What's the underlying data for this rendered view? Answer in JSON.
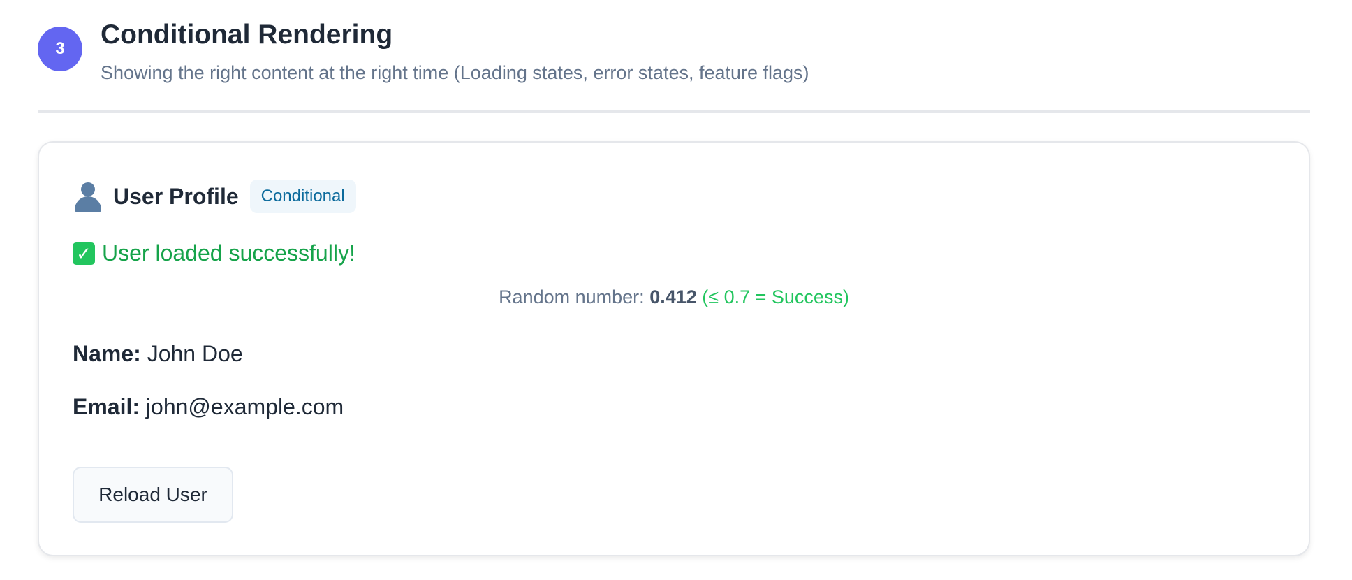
{
  "section": {
    "step_number": "3",
    "title": "Conditional Rendering",
    "subtitle": "Showing the right content at the right time (Loading states, error states, feature flags)"
  },
  "card": {
    "icon": "user-profile-icon",
    "title": "User Profile",
    "badge": "Conditional",
    "status_message": "User loaded successfully!",
    "random_label": "Random number:",
    "random_value": "0.412",
    "random_hint": "(≤ 0.7 = Success)",
    "fields": {
      "name_label": "Name:",
      "name_value": "John Doe",
      "email_label": "Email:",
      "email_value": "john@example.com"
    },
    "reload_button_label": "Reload User"
  },
  "colors": {
    "accent": "#6366f1",
    "success": "#16a34a",
    "badge_text": "#0b6a9c",
    "badge_bg": "#eff6fb"
  }
}
